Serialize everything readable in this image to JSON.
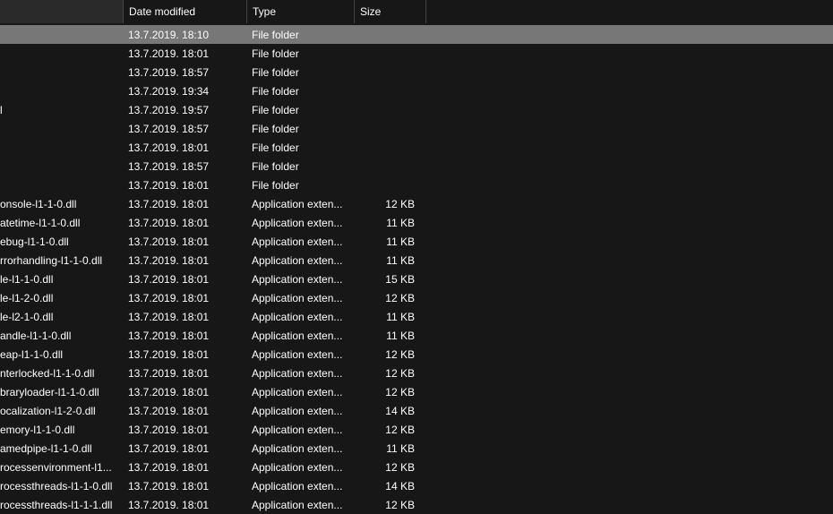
{
  "columns": {
    "name": "",
    "date": "Date modified",
    "type": "Type",
    "size": "Size"
  },
  "rows": [
    {
      "name": "",
      "date": "13.7.2019. 18:10",
      "type": "File folder",
      "size": "",
      "selected": true
    },
    {
      "name": "",
      "date": "13.7.2019. 18:01",
      "type": "File folder",
      "size": ""
    },
    {
      "name": "",
      "date": "13.7.2019. 18:57",
      "type": "File folder",
      "size": ""
    },
    {
      "name": "",
      "date": "13.7.2019. 19:34",
      "type": "File folder",
      "size": ""
    },
    {
      "name": "l",
      "date": "13.7.2019. 19:57",
      "type": "File folder",
      "size": ""
    },
    {
      "name": "",
      "date": "13.7.2019. 18:57",
      "type": "File folder",
      "size": ""
    },
    {
      "name": "",
      "date": "13.7.2019. 18:01",
      "type": "File folder",
      "size": ""
    },
    {
      "name": "",
      "date": "13.7.2019. 18:57",
      "type": "File folder",
      "size": ""
    },
    {
      "name": "",
      "date": "13.7.2019. 18:01",
      "type": "File folder",
      "size": ""
    },
    {
      "name": "onsole-l1-1-0.dll",
      "date": "13.7.2019. 18:01",
      "type": "Application exten...",
      "size": "12 KB"
    },
    {
      "name": "atetime-l1-1-0.dll",
      "date": "13.7.2019. 18:01",
      "type": "Application exten...",
      "size": "11 KB"
    },
    {
      "name": "ebug-l1-1-0.dll",
      "date": "13.7.2019. 18:01",
      "type": "Application exten...",
      "size": "11 KB"
    },
    {
      "name": "rrorhandling-l1-1-0.dll",
      "date": "13.7.2019. 18:01",
      "type": "Application exten...",
      "size": "11 KB"
    },
    {
      "name": "le-l1-1-0.dll",
      "date": "13.7.2019. 18:01",
      "type": "Application exten...",
      "size": "15 KB"
    },
    {
      "name": "le-l1-2-0.dll",
      "date": "13.7.2019. 18:01",
      "type": "Application exten...",
      "size": "12 KB"
    },
    {
      "name": "le-l2-1-0.dll",
      "date": "13.7.2019. 18:01",
      "type": "Application exten...",
      "size": "11 KB"
    },
    {
      "name": "andle-l1-1-0.dll",
      "date": "13.7.2019. 18:01",
      "type": "Application exten...",
      "size": "11 KB"
    },
    {
      "name": "eap-l1-1-0.dll",
      "date": "13.7.2019. 18:01",
      "type": "Application exten...",
      "size": "12 KB"
    },
    {
      "name": "nterlocked-l1-1-0.dll",
      "date": "13.7.2019. 18:01",
      "type": "Application exten...",
      "size": "12 KB"
    },
    {
      "name": "braryloader-l1-1-0.dll",
      "date": "13.7.2019. 18:01",
      "type": "Application exten...",
      "size": "12 KB"
    },
    {
      "name": "ocalization-l1-2-0.dll",
      "date": "13.7.2019. 18:01",
      "type": "Application exten...",
      "size": "14 KB"
    },
    {
      "name": "emory-l1-1-0.dll",
      "date": "13.7.2019. 18:01",
      "type": "Application exten...",
      "size": "12 KB"
    },
    {
      "name": "amedpipe-l1-1-0.dll",
      "date": "13.7.2019. 18:01",
      "type": "Application exten...",
      "size": "11 KB"
    },
    {
      "name": "rocessenvironment-l1...",
      "date": "13.7.2019. 18:01",
      "type": "Application exten...",
      "size": "12 KB"
    },
    {
      "name": "rocessthreads-l1-1-0.dll",
      "date": "13.7.2019. 18:01",
      "type": "Application exten...",
      "size": "14 KB"
    },
    {
      "name": "rocessthreads-l1-1-1.dll",
      "date": "13.7.2019. 18:01",
      "type": "Application exten...",
      "size": "12 KB"
    }
  ]
}
